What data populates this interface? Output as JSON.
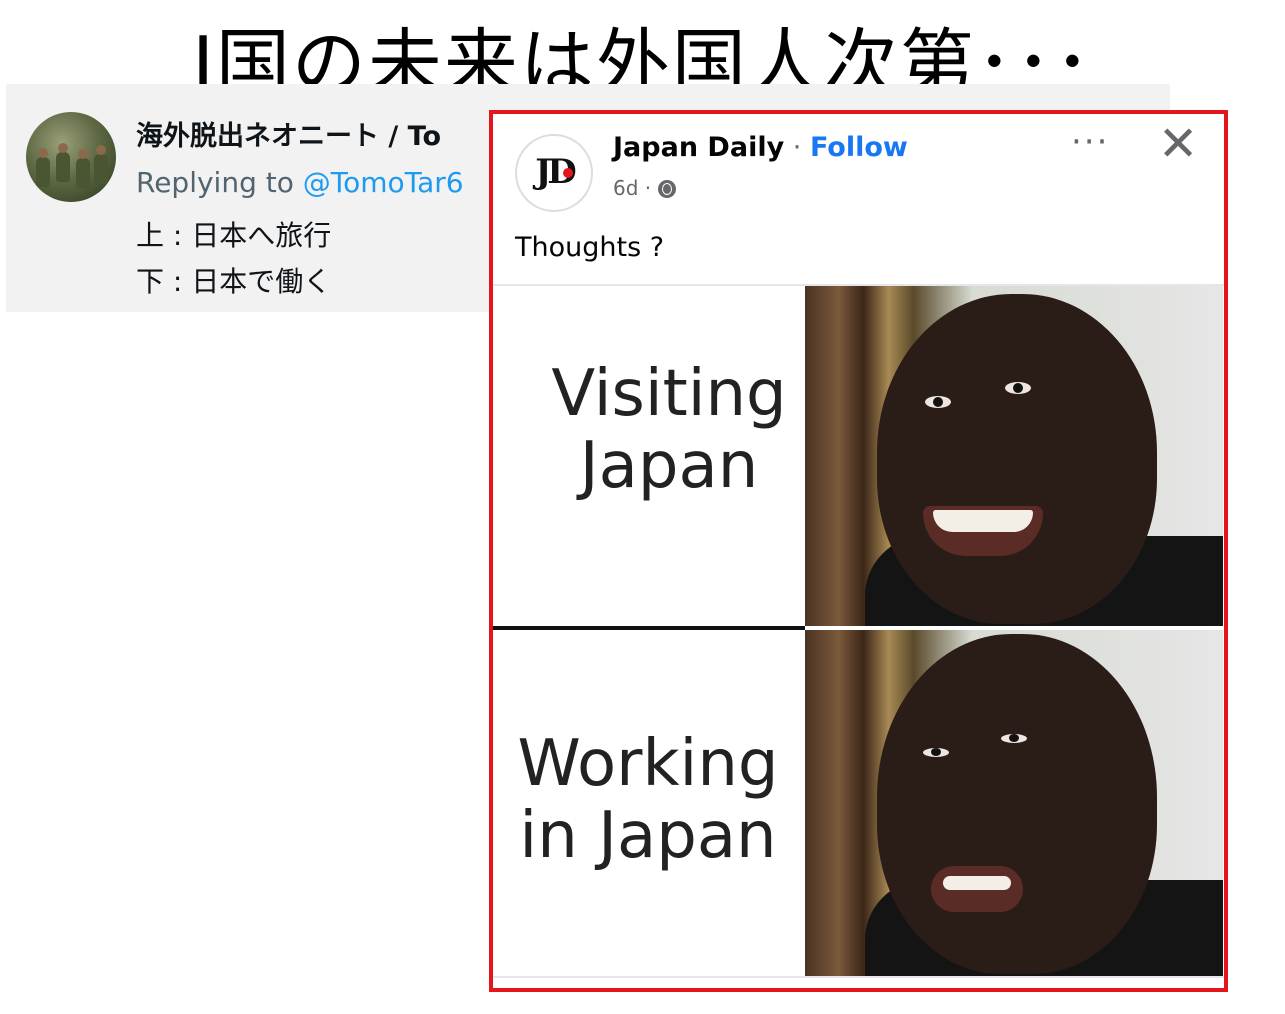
{
  "headline": "J国の未来は外国人次第･･･",
  "tweet": {
    "author": "海外脱出ネオニート / To",
    "replying_prefix": "Replying to ",
    "replying_handle": "@TomoTar6",
    "line1": "上 : 日本へ旅行",
    "line2": "下 : 日本で働く"
  },
  "fb_post": {
    "page_name": "Japan Daily",
    "separator": " · ",
    "follow_label": "Follow",
    "time": "6d · ",
    "more_icon": "···",
    "close_icon": "✕",
    "logo_text": "JD",
    "caption": "Thoughts ?",
    "highlight_color": "#e4151c",
    "follow_color": "#1877f2"
  },
  "meme": {
    "top_line1": "Visiting",
    "top_line2": "Japan",
    "bottom_line1": "Working",
    "bottom_line2": "in Japan"
  }
}
